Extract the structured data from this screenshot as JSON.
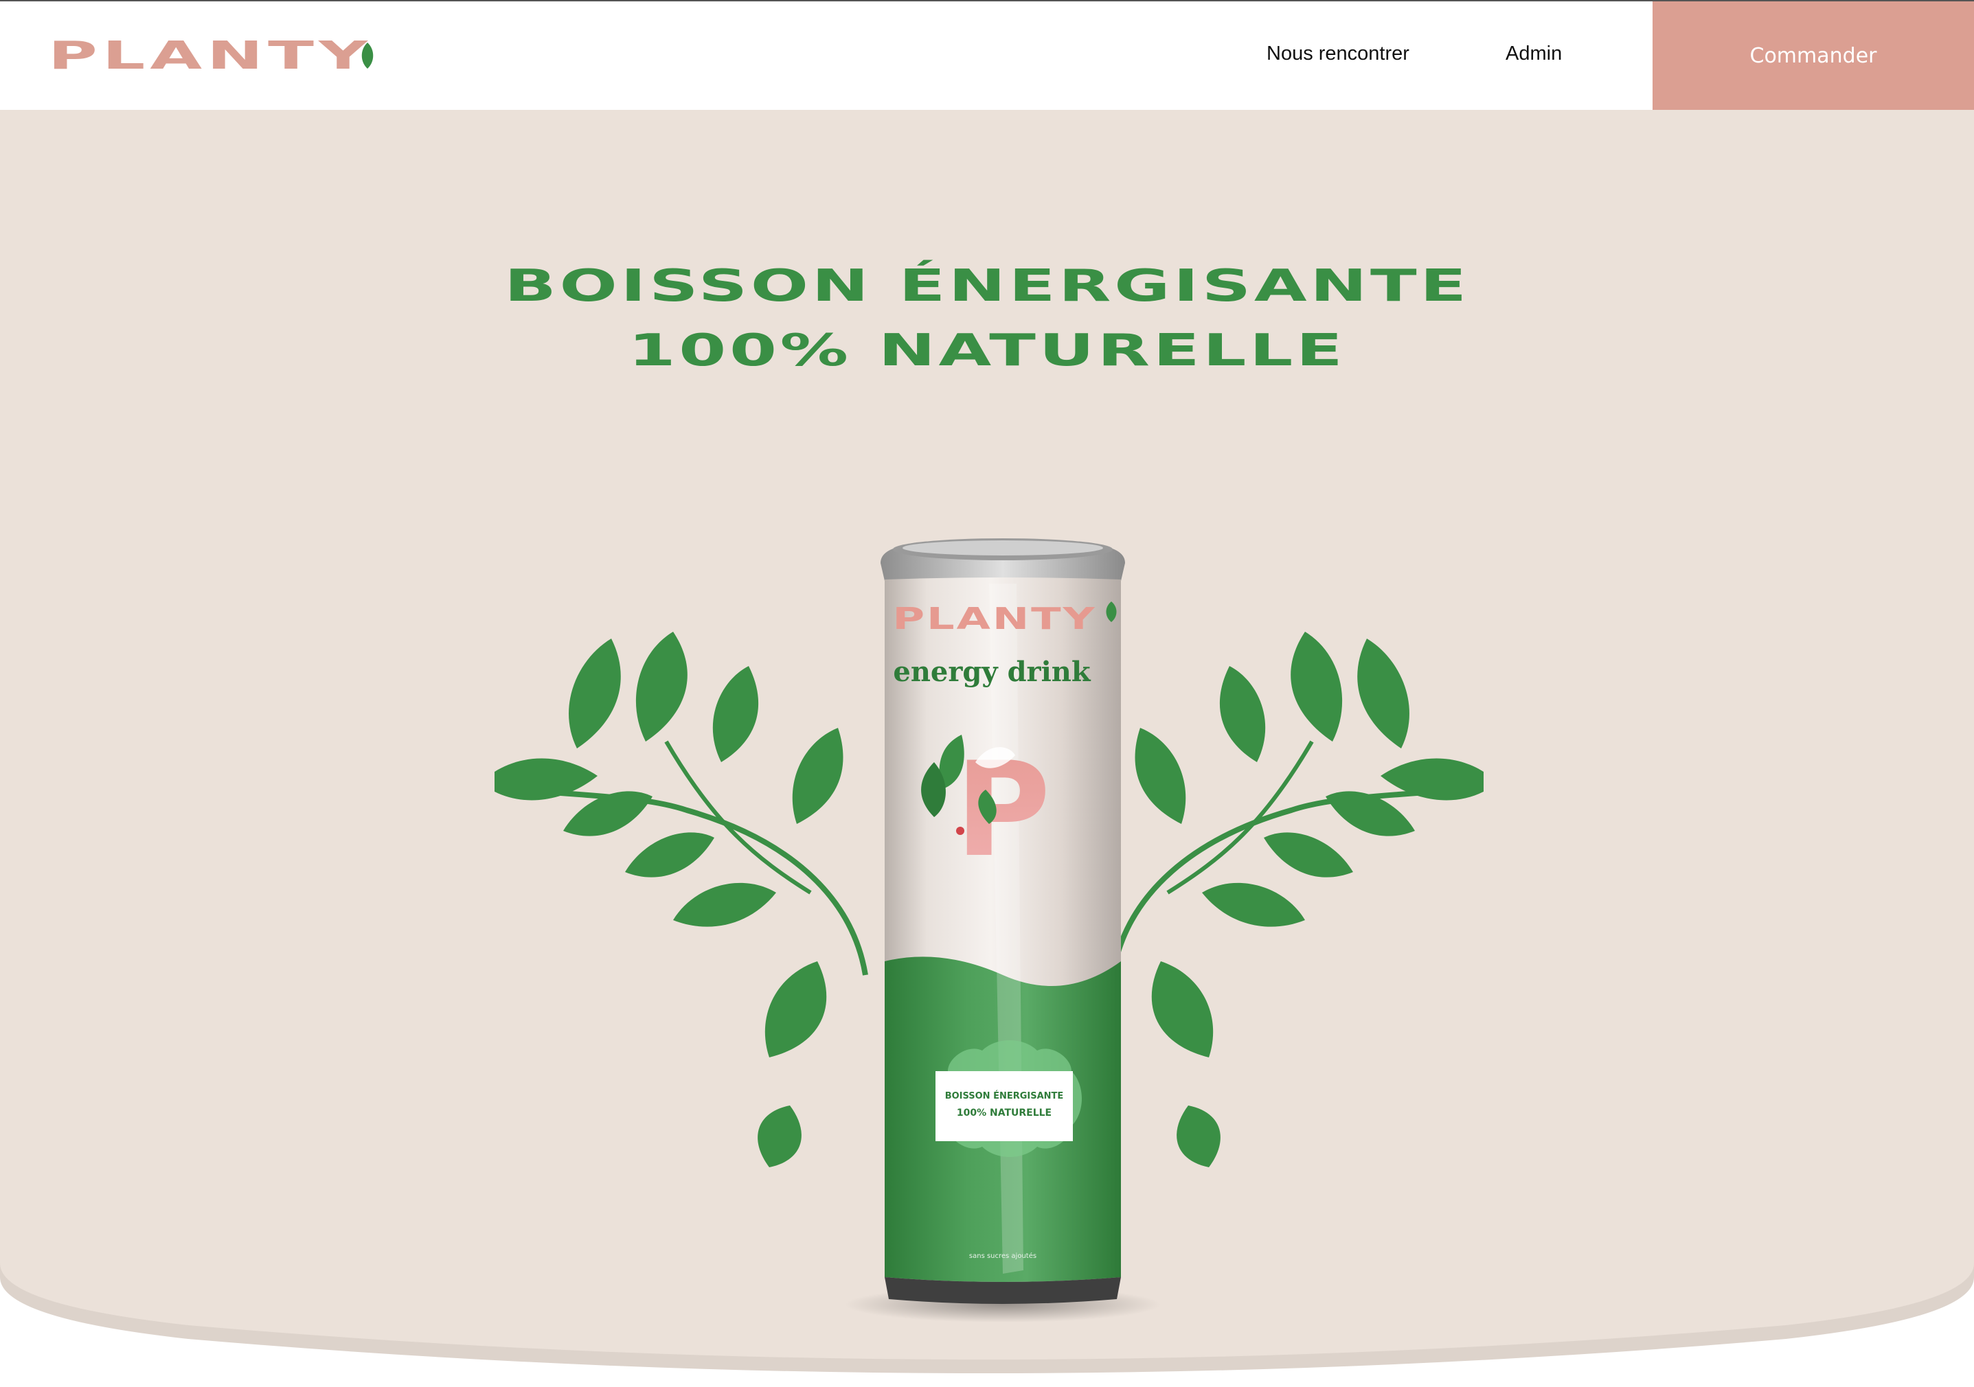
{
  "brand": {
    "name": "PLANTY",
    "primary_color": "#db9f92",
    "accent_color": "#3a8f45",
    "background_color": "#ebe1d9"
  },
  "nav": {
    "links": [
      "Nous rencontrer",
      "Admin"
    ],
    "cta_label": "Commander"
  },
  "hero": {
    "title_line_1": "BOISSON ÉNERGISANTE",
    "title_line_2": "100% NATURELLE",
    "image": {
      "can_brand": "PLANTY",
      "can_subtitle": "energy drink",
      "can_letter": "P",
      "can_label_line_1": "BOISSON ÉNERGISANTE",
      "can_label_line_2": "100% NATURELLE",
      "can_footnote": "sans sucres ajoutés"
    }
  }
}
